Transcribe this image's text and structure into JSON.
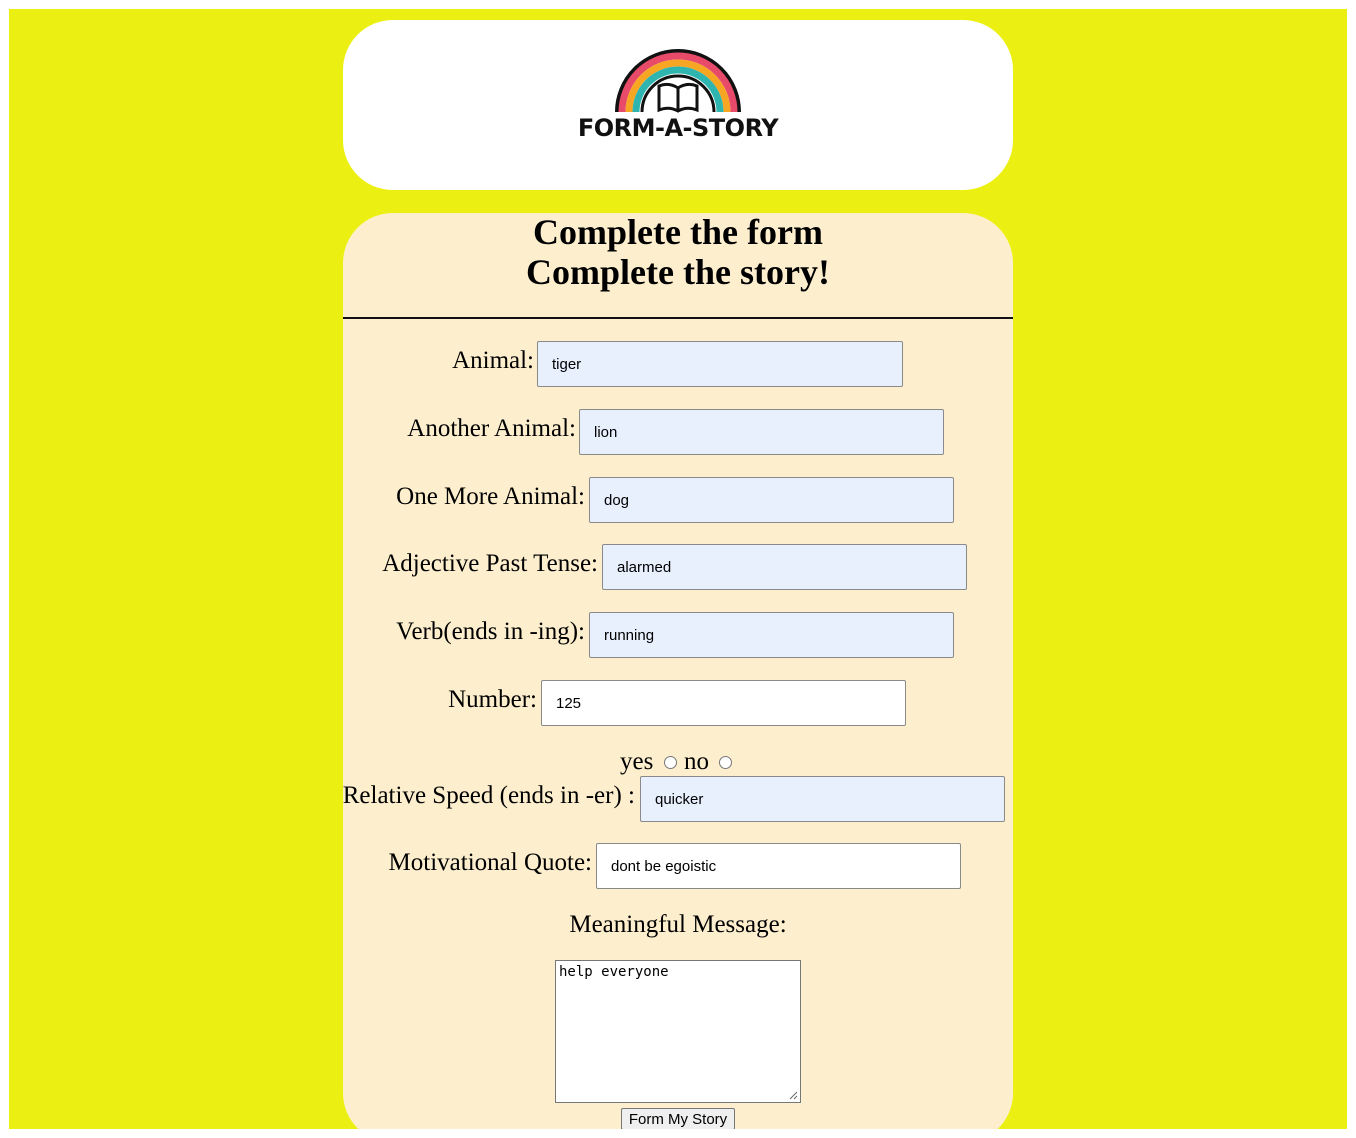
{
  "logo": {
    "text": "FORM-A-STORY",
    "icon": "rainbow-book-icon"
  },
  "colors": {
    "page_bg": "#ecf012",
    "form_bg": "#fdefce",
    "field_filled_bg": "#e8f0fe"
  },
  "heading": {
    "line1": "Complete the form",
    "line2": "Complete the story!"
  },
  "fields": {
    "animal": {
      "label": "Animal:",
      "value": "tiger"
    },
    "another_animal": {
      "label": "Another Animal:",
      "value": "lion"
    },
    "one_more_animal": {
      "label": "One More Animal:",
      "value": "dog"
    },
    "adjective_past": {
      "label": "Adjective Past Tense:",
      "value": "alarmed"
    },
    "verb_ing": {
      "label": "Verb(ends in -ing):",
      "value": "running"
    },
    "number": {
      "label": "Number:",
      "value": "125"
    },
    "relative_speed": {
      "label": "Relative Speed (ends in -er) :",
      "value": "quicker"
    },
    "motivational_quote": {
      "label": "Motivational Quote:",
      "value": "dont be egoistic"
    }
  },
  "radio": {
    "yes_label": "yes",
    "no_label": "no"
  },
  "message": {
    "label": "Meaningful Message:",
    "value": "help everyone"
  },
  "submit_label": "Form My Story"
}
